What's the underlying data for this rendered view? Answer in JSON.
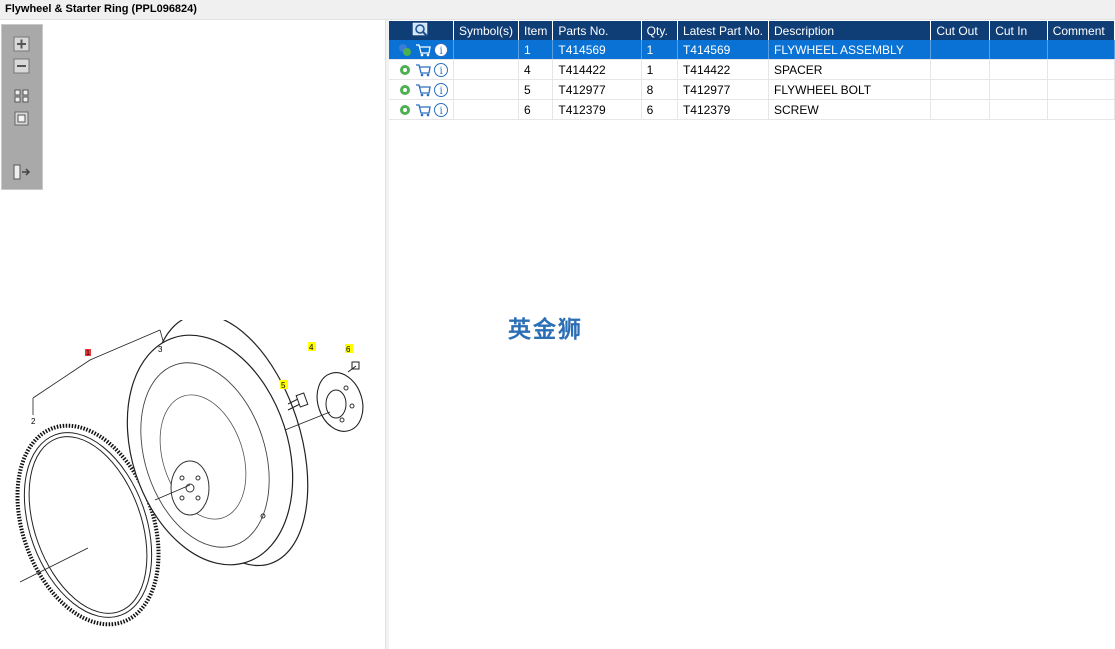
{
  "window": {
    "title": "Flywheel & Starter Ring (PPL096824)"
  },
  "toolbar": {
    "buttons": [
      {
        "name": "zoom-in-icon"
      },
      {
        "name": "zoom-out-icon"
      },
      {
        "name": "fit-all-icon"
      },
      {
        "name": "actual-size-icon"
      },
      {
        "name": "panel-toggle-icon"
      }
    ]
  },
  "diagram": {
    "callouts": [
      "1",
      "2",
      "3",
      "4",
      "5",
      "6"
    ],
    "highlight_color": "#ffff00",
    "selected_color": "#e8383d"
  },
  "table": {
    "columns": [
      "",
      "Symbol(s)",
      "Item",
      "Parts No.",
      "Qty.",
      "Latest Part No.",
      "Description",
      "Cut Out",
      "Cut In",
      "Comment"
    ],
    "rows": [
      {
        "item": "1",
        "parts_no": "T414569",
        "qty": "1",
        "latest": "T414569",
        "description": "FLYWHEEL ASSEMBLY",
        "selected": true
      },
      {
        "item": "4",
        "parts_no": "T414422",
        "qty": "1",
        "latest": "T414422",
        "description": "SPACER",
        "selected": false
      },
      {
        "item": "5",
        "parts_no": "T412977",
        "qty": "8",
        "latest": "T412977",
        "description": "FLYWHEEL BOLT",
        "selected": false
      },
      {
        "item": "6",
        "parts_no": "T412379",
        "qty": "6",
        "latest": "T412379",
        "description": "SCREW",
        "selected": false
      }
    ]
  },
  "watermark": "英金狮",
  "colors": {
    "header_bg": "#0f3e77",
    "selected_row": "#0a72d4",
    "toolbar_bg": "#a9a9a9"
  }
}
